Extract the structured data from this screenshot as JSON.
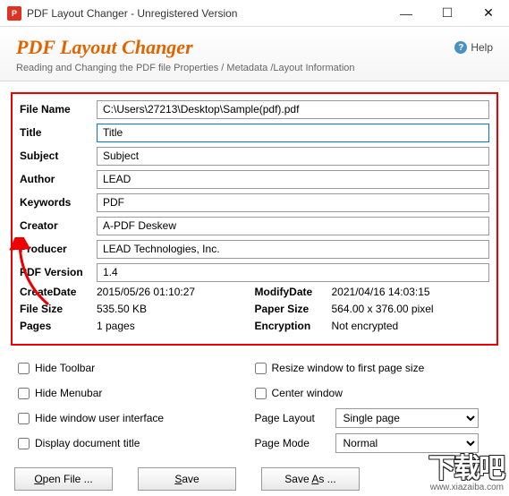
{
  "window": {
    "title": "PDF Layout Changer - Unregistered Version"
  },
  "header": {
    "title": "PDF Layout Changer",
    "sub": "Reading and Changing the PDF file Properties / Metadata /Layout Information",
    "help": "Help"
  },
  "fields": {
    "filename_label": "File Name",
    "filename_value": "C:\\Users\\27213\\Desktop\\Sample(pdf).pdf",
    "title_label": "Title",
    "title_value": "Title",
    "subject_label": "Subject",
    "subject_value": "Subject",
    "author_label": "Author",
    "author_value": "LEAD",
    "keywords_label": "Keywords",
    "keywords_value": "PDF",
    "creator_label": "Creator",
    "creator_value": "A-PDF Deskew",
    "producer_label": "Producer",
    "producer_value": "LEAD Technologies, Inc.",
    "pdfver_label": "PDF Version",
    "pdfver_value": "1.4"
  },
  "info": {
    "create_label": "CreateDate",
    "create_value": "2015/05/26 01:10:27",
    "size_label": "File Size",
    "size_value": "535.50 KB",
    "pages_label": "Pages",
    "pages_value": "1 pages",
    "modify_label": "ModifyDate",
    "modify_value": "2021/04/16 14:03:15",
    "paper_label": "Paper Size",
    "paper_value": "564.00 x 376.00 pixel",
    "encrypt_label": "Encryption",
    "encrypt_value": "Not encrypted"
  },
  "opts": {
    "hide_toolbar": "Hide Toolbar",
    "hide_menubar": "Hide Menubar",
    "hide_ui": "Hide window user interface",
    "display_title": "Display document title",
    "resize": "Resize window to first page size",
    "center": "Center window",
    "layout_label": "Page Layout",
    "layout_value": "Single page",
    "mode_label": "Page Mode",
    "mode_value": "Normal"
  },
  "buttons": {
    "open": "Open File ...",
    "save": "Save",
    "saveas": "Save As ..."
  },
  "watermark": {
    "logo": "下载吧",
    "url": "www.xiazaiba.com"
  }
}
